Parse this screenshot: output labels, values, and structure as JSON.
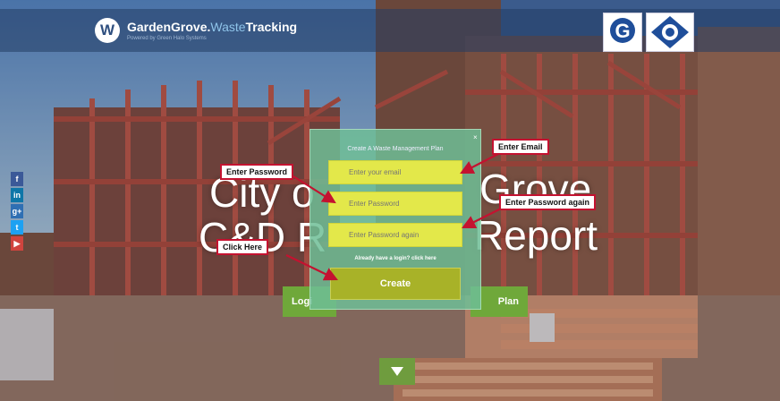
{
  "header": {
    "logo_letter": "W",
    "brand_main": "GardenGrove.",
    "brand_waste": "Waste",
    "brand_end": "Tracking",
    "tagline": "Powered by Green Halo Systems",
    "partner_logo_letter": "G"
  },
  "social": [
    {
      "icon": "facebook-icon",
      "glyph": "f"
    },
    {
      "icon": "linkedin-icon",
      "glyph": "in"
    },
    {
      "icon": "google-plus-icon",
      "glyph": "g+"
    },
    {
      "icon": "twitter-icon",
      "glyph": "t"
    },
    {
      "icon": "youtube-icon",
      "glyph": "▶"
    }
  ],
  "hero": {
    "title_line1_left": "City o",
    "title_line1_right": "Grove",
    "title_line2_left": "C&D R",
    "title_line2_right": "Report",
    "left_button_label": "Logi",
    "right_button_label": "Plan"
  },
  "modal": {
    "close_label": "×",
    "title": "Create A Waste Management Plan",
    "email_placeholder": "Enter your email",
    "password_placeholder": "Enter Password",
    "password_again_placeholder": "Enter Password again",
    "login_link": "Already have a login? click here",
    "create_label": "Create"
  },
  "callouts": {
    "enter_email": "Enter Email",
    "enter_password": "Enter Password",
    "enter_password_again": "Enter Password again",
    "click_here": "Click Here"
  },
  "colors": {
    "callout_border": "#c41230",
    "field_yellow": "#e3e84a",
    "create_button": "#a8b228",
    "hero_button_green": "#6fa83a"
  }
}
